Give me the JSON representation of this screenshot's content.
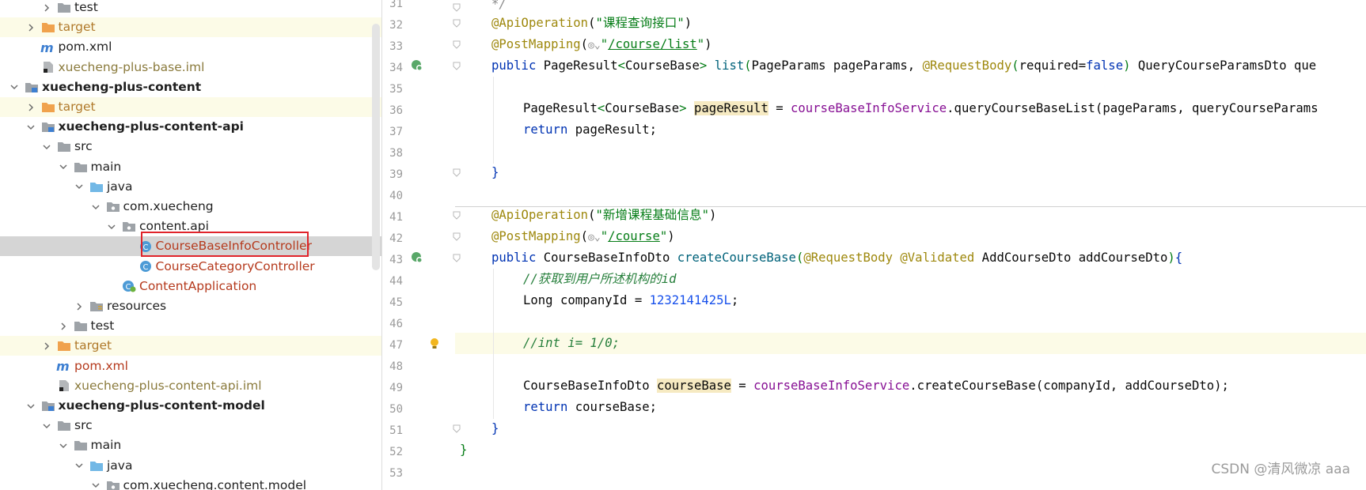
{
  "tree": {
    "items": [
      {
        "label": "test",
        "style": "normal",
        "depth": 2,
        "arrow": "right",
        "icon": "folder-icon"
      },
      {
        "label": "target",
        "style": "orange",
        "depth": 1,
        "arrow": "right",
        "icon": "folder-orange-icon",
        "bg": "yellow"
      },
      {
        "label": "pom.xml",
        "style": "normal",
        "depth": 1,
        "arrow": "none",
        "icon": "maven-icon"
      },
      {
        "label": "xuecheng-plus-base.iml",
        "style": "olive",
        "depth": 1,
        "arrow": "none",
        "icon": "iml-file-icon"
      },
      {
        "label": "xuecheng-plus-content",
        "style": "bold",
        "depth": 0,
        "arrow": "down",
        "icon": "module-icon"
      },
      {
        "label": "target",
        "style": "orange",
        "depth": 1,
        "arrow": "right",
        "icon": "folder-orange-icon",
        "bg": "yellow"
      },
      {
        "label": "xuecheng-plus-content-api",
        "style": "bold",
        "depth": 1,
        "arrow": "down",
        "icon": "module-icon"
      },
      {
        "label": "src",
        "style": "normal",
        "depth": 2,
        "arrow": "down",
        "icon": "folder-icon"
      },
      {
        "label": "main",
        "style": "normal",
        "depth": 3,
        "arrow": "down",
        "icon": "folder-icon"
      },
      {
        "label": "java",
        "style": "normal",
        "depth": 4,
        "arrow": "down",
        "icon": "folder-blue-icon"
      },
      {
        "label": "com.xuecheng",
        "style": "normal",
        "depth": 5,
        "arrow": "down",
        "icon": "package-icon"
      },
      {
        "label": "content.api",
        "style": "normal",
        "depth": 6,
        "arrow": "down",
        "icon": "package-icon"
      },
      {
        "label": "CourseBaseInfoController",
        "style": "red",
        "depth": 7,
        "arrow": "none",
        "icon": "class-icon",
        "bg": "selected"
      },
      {
        "label": "CourseCategoryController",
        "style": "red",
        "depth": 7,
        "arrow": "none",
        "icon": "class-icon"
      },
      {
        "label": "ContentApplication",
        "style": "red",
        "depth": 6,
        "arrow": "none",
        "icon": "spring-class-icon"
      },
      {
        "label": "resources",
        "style": "normal",
        "depth": 4,
        "arrow": "right",
        "icon": "resources-icon"
      },
      {
        "label": "test",
        "style": "normal",
        "depth": 3,
        "arrow": "right",
        "icon": "folder-icon"
      },
      {
        "label": "target",
        "style": "orange",
        "depth": 2,
        "arrow": "right",
        "icon": "folder-orange-icon",
        "bg": "yellow"
      },
      {
        "label": "pom.xml",
        "style": "red",
        "depth": 2,
        "arrow": "none",
        "icon": "maven-icon"
      },
      {
        "label": "xuecheng-plus-content-api.iml",
        "style": "olive",
        "depth": 2,
        "arrow": "none",
        "icon": "iml-file-icon"
      },
      {
        "label": "xuecheng-plus-content-model",
        "style": "bold",
        "depth": 1,
        "arrow": "down",
        "icon": "module-icon"
      },
      {
        "label": "src",
        "style": "normal",
        "depth": 2,
        "arrow": "down",
        "icon": "folder-icon"
      },
      {
        "label": "main",
        "style": "normal",
        "depth": 3,
        "arrow": "down",
        "icon": "folder-icon"
      },
      {
        "label": "java",
        "style": "normal",
        "depth": 4,
        "arrow": "down",
        "icon": "folder-blue-icon"
      },
      {
        "label": "com.xuecheng.content.model",
        "style": "normal",
        "depth": 5,
        "arrow": "down",
        "icon": "package-icon"
      }
    ]
  },
  "editor": {
    "line_numbers": [
      "31",
      "32",
      "33",
      "34",
      "35",
      "36",
      "37",
      "38",
      "39",
      "40",
      "41",
      "42",
      "43",
      "44",
      "45",
      "46",
      "47",
      "48",
      "49",
      "50",
      "51",
      "52",
      "53"
    ],
    "current_line": "47",
    "lines": {
      "l31": "*/",
      "l32_ann": "@ApiOperation",
      "l32_str": "\"课程查询接口\"",
      "l33_ann": "@PostMapping",
      "l33_url": "/course/list",
      "l34_kw": "public",
      "l34_type": "PageResult",
      "l34_gen": "CourseBase",
      "l34_method": "list",
      "l34_p1": "PageParams pageParams, ",
      "l34_ann": "@RequestBody",
      "l34_req": "required",
      "l34_false": "false",
      "l34_rest": " QueryCourseParamsDto que",
      "l36_type": "PageResult",
      "l36_gen": "CourseBase",
      "l36_var": "pageResult",
      "l36_field": "courseBaseInfoService",
      "l36_call": ".queryCourseBaseList(pageParams, queryCourseParams",
      "l37_kw": "return",
      "l37_rest": " pageResult;",
      "l39": "}",
      "l41_ann": "@ApiOperation",
      "l41_str": "\"新增课程基础信息\"",
      "l42_ann": "@PostMapping",
      "l42_url": "/course",
      "l43_kw": "public",
      "l43_type": "CourseBaseInfoDto ",
      "l43_method": "createCourseBase",
      "l43_ann1": "@RequestBody",
      "l43_ann2": "@Validated",
      "l43_rest": " AddCourseDto addCourseDto",
      "l44": "//获取到用户所述机构的id",
      "l45_a": "Long companyId = ",
      "l45_num": "1232141425L",
      "l47": "//int i= 1/0;",
      "l49_a": "CourseBaseInfoDto ",
      "l49_var": "courseBase",
      "l49_field": "courseBaseInfoService",
      "l49_call": ".createCourseBase(companyId, addCourseDto);",
      "l50_kw": "return",
      "l50_rest": " courseBase;",
      "l51": "}",
      "l52": "}"
    }
  },
  "watermark": "CSDN @清风微凉 aaa",
  "colors": {
    "annotation": "#9e880d",
    "string": "#067d17",
    "keyword": "#0033b3",
    "field": "#871094",
    "method": "#00627a",
    "number": "#1750eb",
    "selection_box": "#e0242b"
  }
}
